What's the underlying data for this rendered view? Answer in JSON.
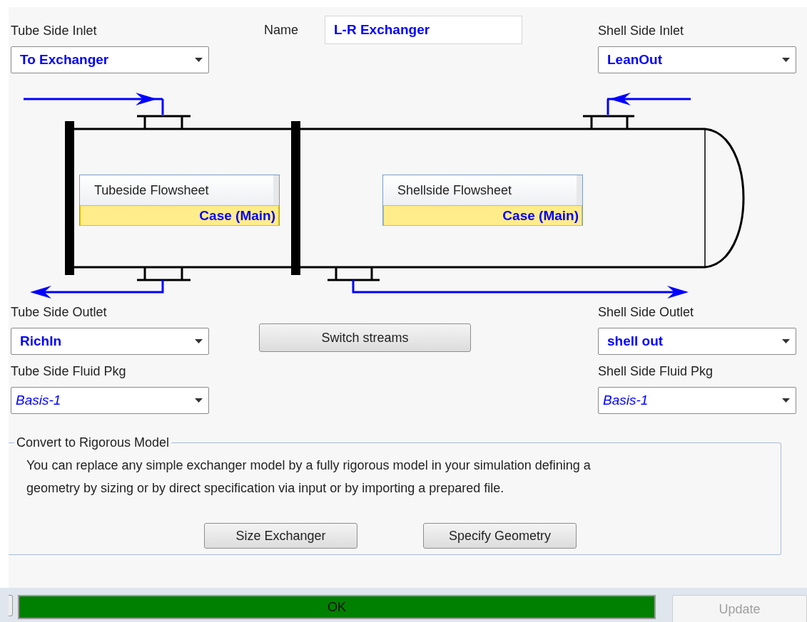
{
  "tube_side_inlet": {
    "label": "Tube Side Inlet",
    "value": "To Exchanger"
  },
  "name": {
    "label": "Name",
    "value": "L-R Exchanger"
  },
  "shell_side_inlet": {
    "label": "Shell Side Inlet",
    "value": "LeanOut"
  },
  "flowsheets": [
    {
      "title": "Tubeside Flowsheet",
      "case": "Case (Main)",
      "selected": true
    },
    {
      "title": "Shellside Flowsheet",
      "case": "Case (Main)",
      "selected": true
    }
  ],
  "tube_side_outlet": {
    "label": "Tube Side Outlet",
    "value": "RichIn"
  },
  "switch_button": "Switch streams",
  "shell_side_outlet": {
    "label": "Shell Side Outlet",
    "value": "shell out"
  },
  "tube_side_fluid_pkg": {
    "label": "Tube Side Fluid Pkg",
    "value": "Basis-1"
  },
  "shell_side_fluid_pkg": {
    "label": "Shell Side Fluid Pkg",
    "value": "Basis-1"
  },
  "rigorous": {
    "title": "Convert to Rigorous Model",
    "text": "You can replace any simple exchanger model by a fully rigorous model in your simulation defining a geometry by sizing or by direct specification via input or by importing a prepared file.",
    "buttons": [
      "Size Exchanger",
      "Specify Geometry"
    ]
  },
  "status": {
    "text": "OK"
  },
  "update_button": {
    "label": "Update",
    "disabled": true
  }
}
